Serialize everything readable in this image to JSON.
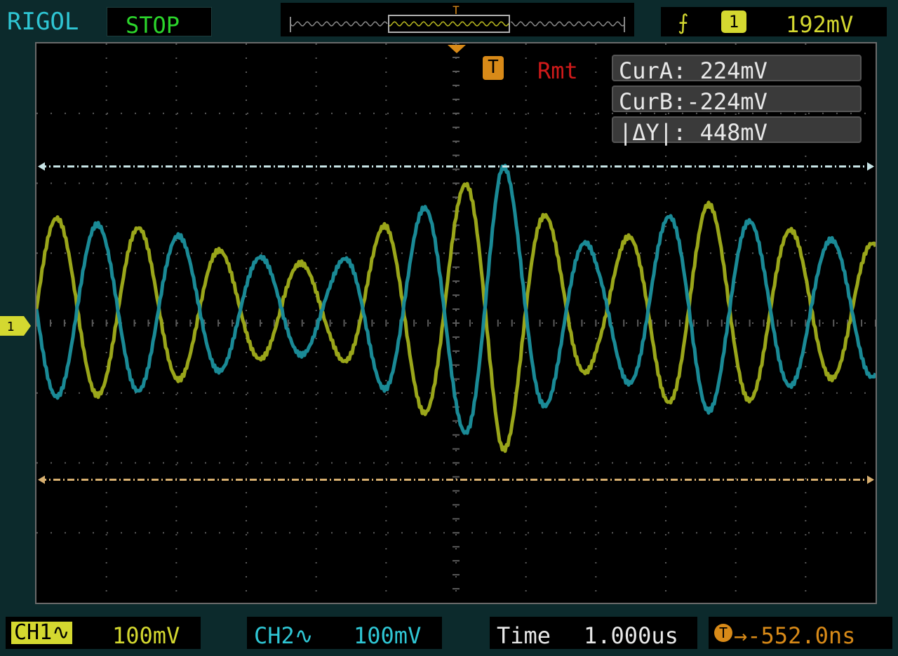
{
  "header": {
    "brand": "RIGOL",
    "run_status": "STOP",
    "trigger_marker": "T",
    "trigger_source": "1",
    "trigger_level": "192mV",
    "edge_icon": "rising-edge-icon"
  },
  "screen": {
    "remote": "Rmt",
    "trigger_position_marker": "T",
    "channel1_marker": "1",
    "cursors": [
      {
        "label": "CurA:  224mV"
      },
      {
        "label": "CurB:-224mV"
      },
      {
        "label": "|ΔY|:  448mV"
      }
    ],
    "cursor_levels_mV": {
      "a": 224,
      "b": -224
    },
    "colors": {
      "ch1": "#9aa61a",
      "ch2": "#1a8a96",
      "cursor_a": "#c8e4e6",
      "cursor_b": "#d8b070",
      "grid": "#5a5a5a"
    }
  },
  "channels": {
    "ch1": {
      "label": "CH1",
      "coupling_icon": "ac-coupling-icon",
      "scale": "100mV"
    },
    "ch2": {
      "label": "CH2",
      "coupling_icon": "ac-coupling-icon",
      "scale": "100mV"
    }
  },
  "timebase": {
    "label": "Time",
    "value": "1.000us"
  },
  "trigger_offset": {
    "icon": "T",
    "value": "→-552.0ns"
  }
}
